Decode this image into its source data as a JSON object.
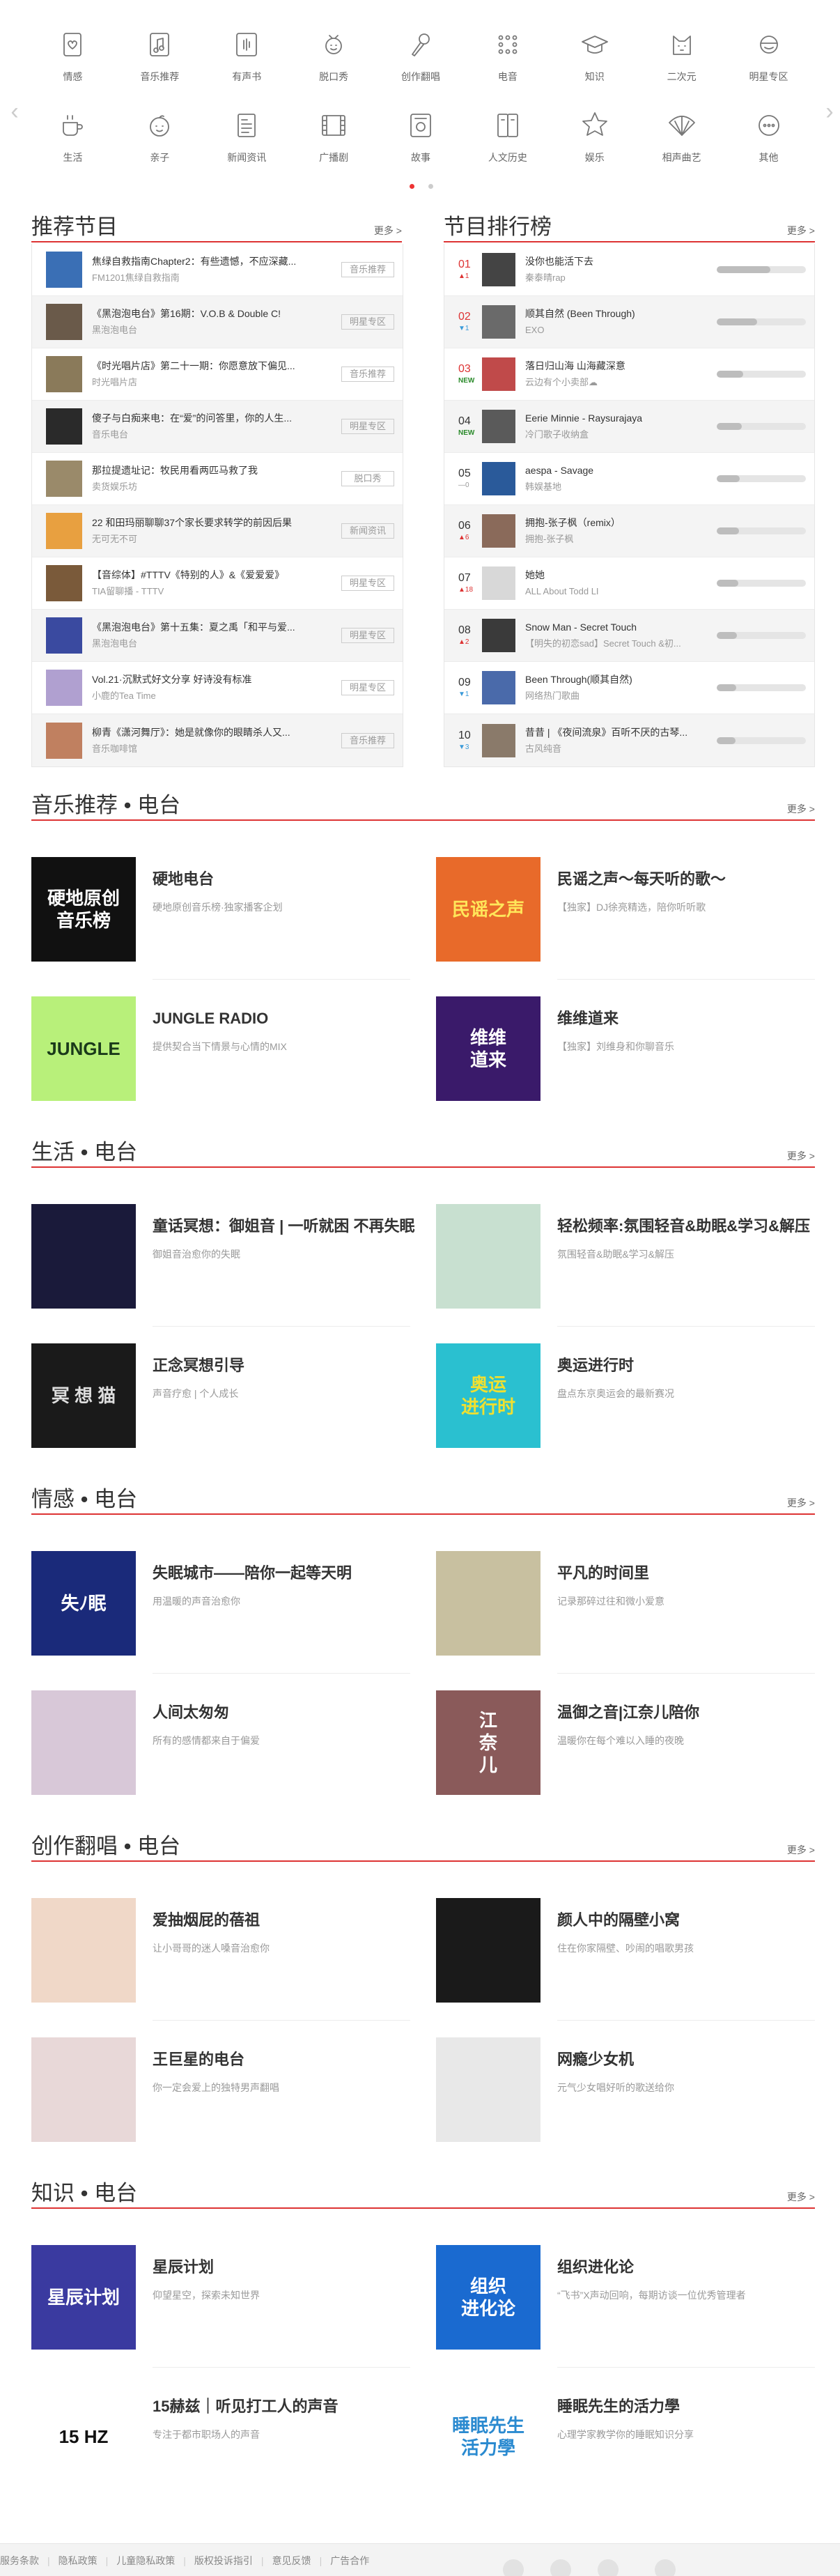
{
  "categories": [
    {
      "label": "情感",
      "icon": "heart-note-icon"
    },
    {
      "label": "音乐推荐",
      "icon": "music-note-icon"
    },
    {
      "label": "有声书",
      "icon": "audiobook-icon"
    },
    {
      "label": "脱口秀",
      "icon": "talkshow-face-icon"
    },
    {
      "label": "创作翻唱",
      "icon": "microphone-icon"
    },
    {
      "label": "电音",
      "icon": "dots-grid-icon"
    },
    {
      "label": "知识",
      "icon": "graduation-cap-icon"
    },
    {
      "label": "二次元",
      "icon": "anime-cat-icon"
    },
    {
      "label": "明星专区",
      "icon": "star-face-icon"
    },
    {
      "label": "生活",
      "icon": "coffee-cup-icon"
    },
    {
      "label": "亲子",
      "icon": "kid-face-icon"
    },
    {
      "label": "新闻资讯",
      "icon": "newspaper-icon"
    },
    {
      "label": "广播剧",
      "icon": "film-strip-icon"
    },
    {
      "label": "故事",
      "icon": "radio-box-icon"
    },
    {
      "label": "人文历史",
      "icon": "book-icon"
    },
    {
      "label": "娱乐",
      "icon": "smile-star-icon"
    },
    {
      "label": "相声曲艺",
      "icon": "fan-icon"
    },
    {
      "label": "其他",
      "icon": "more-dots-icon"
    }
  ],
  "recommend": {
    "title": "推荐节目",
    "more": "更多 >",
    "items": [
      {
        "title": "焦绿自救指南Chapter2：有些遗憾，不应深藏...",
        "sub": "FM1201焦绿自救指南",
        "tag": "音乐推荐",
        "color": "#3a6fb5"
      },
      {
        "title": "《黑泡泡电台》第16期：V.O.B & Double C!",
        "sub": "黑泡泡电台",
        "tag": "明星专区",
        "color": "#6a5a4a"
      },
      {
        "title": "《时光唱片店》第二十一期：你愿意放下偏见...",
        "sub": "时光唱片店",
        "tag": "音乐推荐",
        "color": "#8a7a5a"
      },
      {
        "title": "傻子与白痴来电：在“爱”的问答里，你的人生...",
        "sub": "音乐电台",
        "tag": "明星专区",
        "color": "#2a2a2a"
      },
      {
        "title": "那拉提遗址记：牧民用看两匹马救了我",
        "sub": "卖货娱乐坊",
        "tag": "脱口秀",
        "color": "#9a8a6a"
      },
      {
        "title": "22 和田玛丽聊聊37个家长要求转学的前因后果",
        "sub": "无可无不可",
        "tag": "新闻资讯",
        "color": "#e8a040"
      },
      {
        "title": "【音综体】#TTTV《特别的人》&《爱爱爱》",
        "sub": "TIA留聊播 - TTTV",
        "tag": "明星专区",
        "color": "#7a5a3a"
      },
      {
        "title": "《黑泡泡电台》第十五集：夏之禹「和平与爱...",
        "sub": "黑泡泡电台",
        "tag": "明星专区",
        "color": "#3a4aa0"
      },
      {
        "title": "Vol.21·沉默式好文分享 好诗没有标准",
        "sub": "小鹿的Tea Time",
        "tag": "明星专区",
        "color": "#b0a0d0"
      },
      {
        "title": "柳青《潇河舞厅》：她是就像你的眼睛杀人又...",
        "sub": "音乐咖啡馆",
        "tag": "音乐推荐",
        "color": "#c08060"
      }
    ]
  },
  "ranking": {
    "title": "节目排行榜",
    "more": "更多 >",
    "items": [
      {
        "rank": "01",
        "change": "▲1",
        "ctype": "up",
        "title": "没你也能活下去",
        "sub": "秦泰晴rap",
        "pct": 0.6,
        "color": "#444"
      },
      {
        "rank": "02",
        "change": "▼1",
        "ctype": "dn",
        "title": "顺其自然 (Been Through)",
        "sub": "EXO",
        "pct": 0.45,
        "color": "#6a6a6a"
      },
      {
        "rank": "03",
        "change": "NEW",
        "ctype": "nw",
        "title": "落日归山海 山海藏深意",
        "sub": "云边有个小卖部☁",
        "pct": 0.3,
        "color": "#c04a4a"
      },
      {
        "rank": "04",
        "change": "NEW",
        "ctype": "nw",
        "title": "Eerie Minnie - Raysurajaya",
        "sub": "冷门歌子收纳盒",
        "pct": 0.28,
        "color": "#5a5a5a"
      },
      {
        "rank": "05",
        "change": "—0",
        "ctype": "eq",
        "title": "aespa - Savage",
        "sub": "韩娱基地",
        "pct": 0.26,
        "color": "#2a5a9a"
      },
      {
        "rank": "06",
        "change": "▲6",
        "ctype": "up",
        "title": "拥抱-张子枫（remix）",
        "sub": "拥抱-张子枫",
        "pct": 0.25,
        "color": "#8a6a5a"
      },
      {
        "rank": "07",
        "change": "▲18",
        "ctype": "up",
        "title": "她她",
        "sub": "ALL About Todd LI",
        "pct": 0.24,
        "color": "#d8d8d8"
      },
      {
        "rank": "08",
        "change": "▲2",
        "ctype": "up",
        "title": "Snow Man - Secret Touch",
        "sub": "【明失的初恋sad】Secret Touch &初...",
        "pct": 0.23,
        "color": "#3a3a3a"
      },
      {
        "rank": "09",
        "change": "▼1",
        "ctype": "dn",
        "title": "Been Through(顺其自然)",
        "sub": "网络热门歌曲",
        "pct": 0.22,
        "color": "#4a6aaa"
      },
      {
        "rank": "10",
        "change": "▼3",
        "ctype": "dn",
        "title": "昔昔 | 《夜间流泉》百听不厌的古琴...",
        "sub": "古风纯音",
        "pct": 0.21,
        "color": "#8a7a6a"
      }
    ]
  },
  "sections": [
    {
      "title": "音乐推荐 • 电台",
      "more": "更多 >",
      "cards": [
        {
          "name": "硬地电台",
          "desc": "硬地原创音乐榜·独家播客企划",
          "img": "硬地原创\n音乐榜",
          "bg": "#111",
          "fg": "#fff"
        },
        {
          "name": "民谣之声～每天听的歌～",
          "desc": "【独家】DJ徐亮精选，陪你听听歌",
          "img": "民谣之声",
          "bg": "#e86a2a",
          "fg": "#ffe65a"
        },
        {
          "name": "JUNGLE RADIO",
          "desc": "提供契合当下情景与心情的MIX",
          "img": "JUNGLE",
          "bg": "#b8f07a",
          "fg": "#1a3a1a"
        },
        {
          "name": "维维道来",
          "desc": "【独家】刘维身和你聊音乐",
          "img": "维维\n道来",
          "bg": "#3a1a6a",
          "fg": "#fff"
        }
      ]
    },
    {
      "title": "生活 • 电台",
      "more": "更多 >",
      "cards": [
        {
          "name": "童话冥想：御姐音 | 一听就困 不再失眠",
          "desc": "御姐音治愈你的失眠",
          "img": "",
          "bg": "#1a1a3a",
          "fg": "#fff"
        },
        {
          "name": "轻松频率:氛围轻音&助眠&学习&解压",
          "desc": "氛围轻音&助眠&学习&解压",
          "img": "",
          "bg": "#c8e0d0",
          "fg": "#fff"
        },
        {
          "name": "正念冥想引导",
          "desc": "声音疗愈 | 个人成长",
          "img": "冥 想 猫",
          "bg": "#1a1a1a",
          "fg": "#ddd"
        },
        {
          "name": "奥运进行时",
          "desc": "盘点东京奥运会的最新赛况",
          "img": "奥运\n进行时",
          "bg": "#2ac0d0",
          "fg": "#f0e030"
        }
      ]
    },
    {
      "title": "情感 • 电台",
      "more": "更多 >",
      "cards": [
        {
          "name": "失眠城市——陪你一起等天明",
          "desc": "用温暖的声音治愈你",
          "img": "失ﾉ眠",
          "bg": "#1a2a7a",
          "fg": "#fff"
        },
        {
          "name": "平凡的时间里",
          "desc": "记录那碎过往和微小爱意",
          "img": "",
          "bg": "#c8c0a0",
          "fg": "#fff"
        },
        {
          "name": "人间太匆匆",
          "desc": "所有的感情都来自于偏爱",
          "img": "",
          "bg": "#d8c8d8",
          "fg": "#fff"
        },
        {
          "name": "温御之音|江奈儿陪你",
          "desc": "温暖你在每个难以入睡的夜晚",
          "img": "江\n奈\n儿",
          "bg": "#8a5a5a",
          "fg": "#fff"
        }
      ]
    },
    {
      "title": "创作翻唱 • 电台",
      "more": "更多 >",
      "cards": [
        {
          "name": "爱抽烟屁的蓓祖",
          "desc": "让小哥哥的迷人嗓音治愈你",
          "img": "",
          "bg": "#f0d8c8",
          "fg": "#fff"
        },
        {
          "name": "颜人中的隔壁小窝",
          "desc": "住在你家隔壁、吵闹的唱歌男孩",
          "img": "",
          "bg": "#1a1a1a",
          "fg": "#fff"
        },
        {
          "name": "王巨星的电台",
          "desc": "你一定会爱上的独特男声翻唱",
          "img": "",
          "bg": "#e8d8d8",
          "fg": "#fff"
        },
        {
          "name": "网瘾少女机",
          "desc": "元气少女唱好听的歌送给你",
          "img": "",
          "bg": "#e8e8e8",
          "fg": "#fff"
        }
      ]
    },
    {
      "title": "知识 • 电台",
      "more": "更多 >",
      "cards": [
        {
          "name": "星辰计划",
          "desc": "仰望星空，探索未知世界",
          "img": "星辰计划",
          "bg": "#3a3aa0",
          "fg": "#fff"
        },
        {
          "name": "组织进化论",
          "desc": "“飞书”X声动回响，每期访谈一位优秀管理者",
          "img": "组织\n进化论",
          "bg": "#1a6ad0",
          "fg": "#fff"
        },
        {
          "name": "15赫兹｜听见打工人的声音",
          "desc": "专注于都市职场人的声音",
          "img": "15 HZ",
          "bg": "#fff",
          "fg": "#111"
        },
        {
          "name": "睡眠先生的活力學",
          "desc": "心理学家教学你的睡眠知识分享",
          "img": "睡眠先生\n活力學",
          "bg": "#fff",
          "fg": "#2a8ad0"
        }
      ]
    }
  ],
  "footer": {
    "links": [
      "服务条款",
      "隐私政策",
      "儿童隐私政策",
      "版权投诉指引",
      "意见反馈",
      "广告合作"
    ]
  }
}
